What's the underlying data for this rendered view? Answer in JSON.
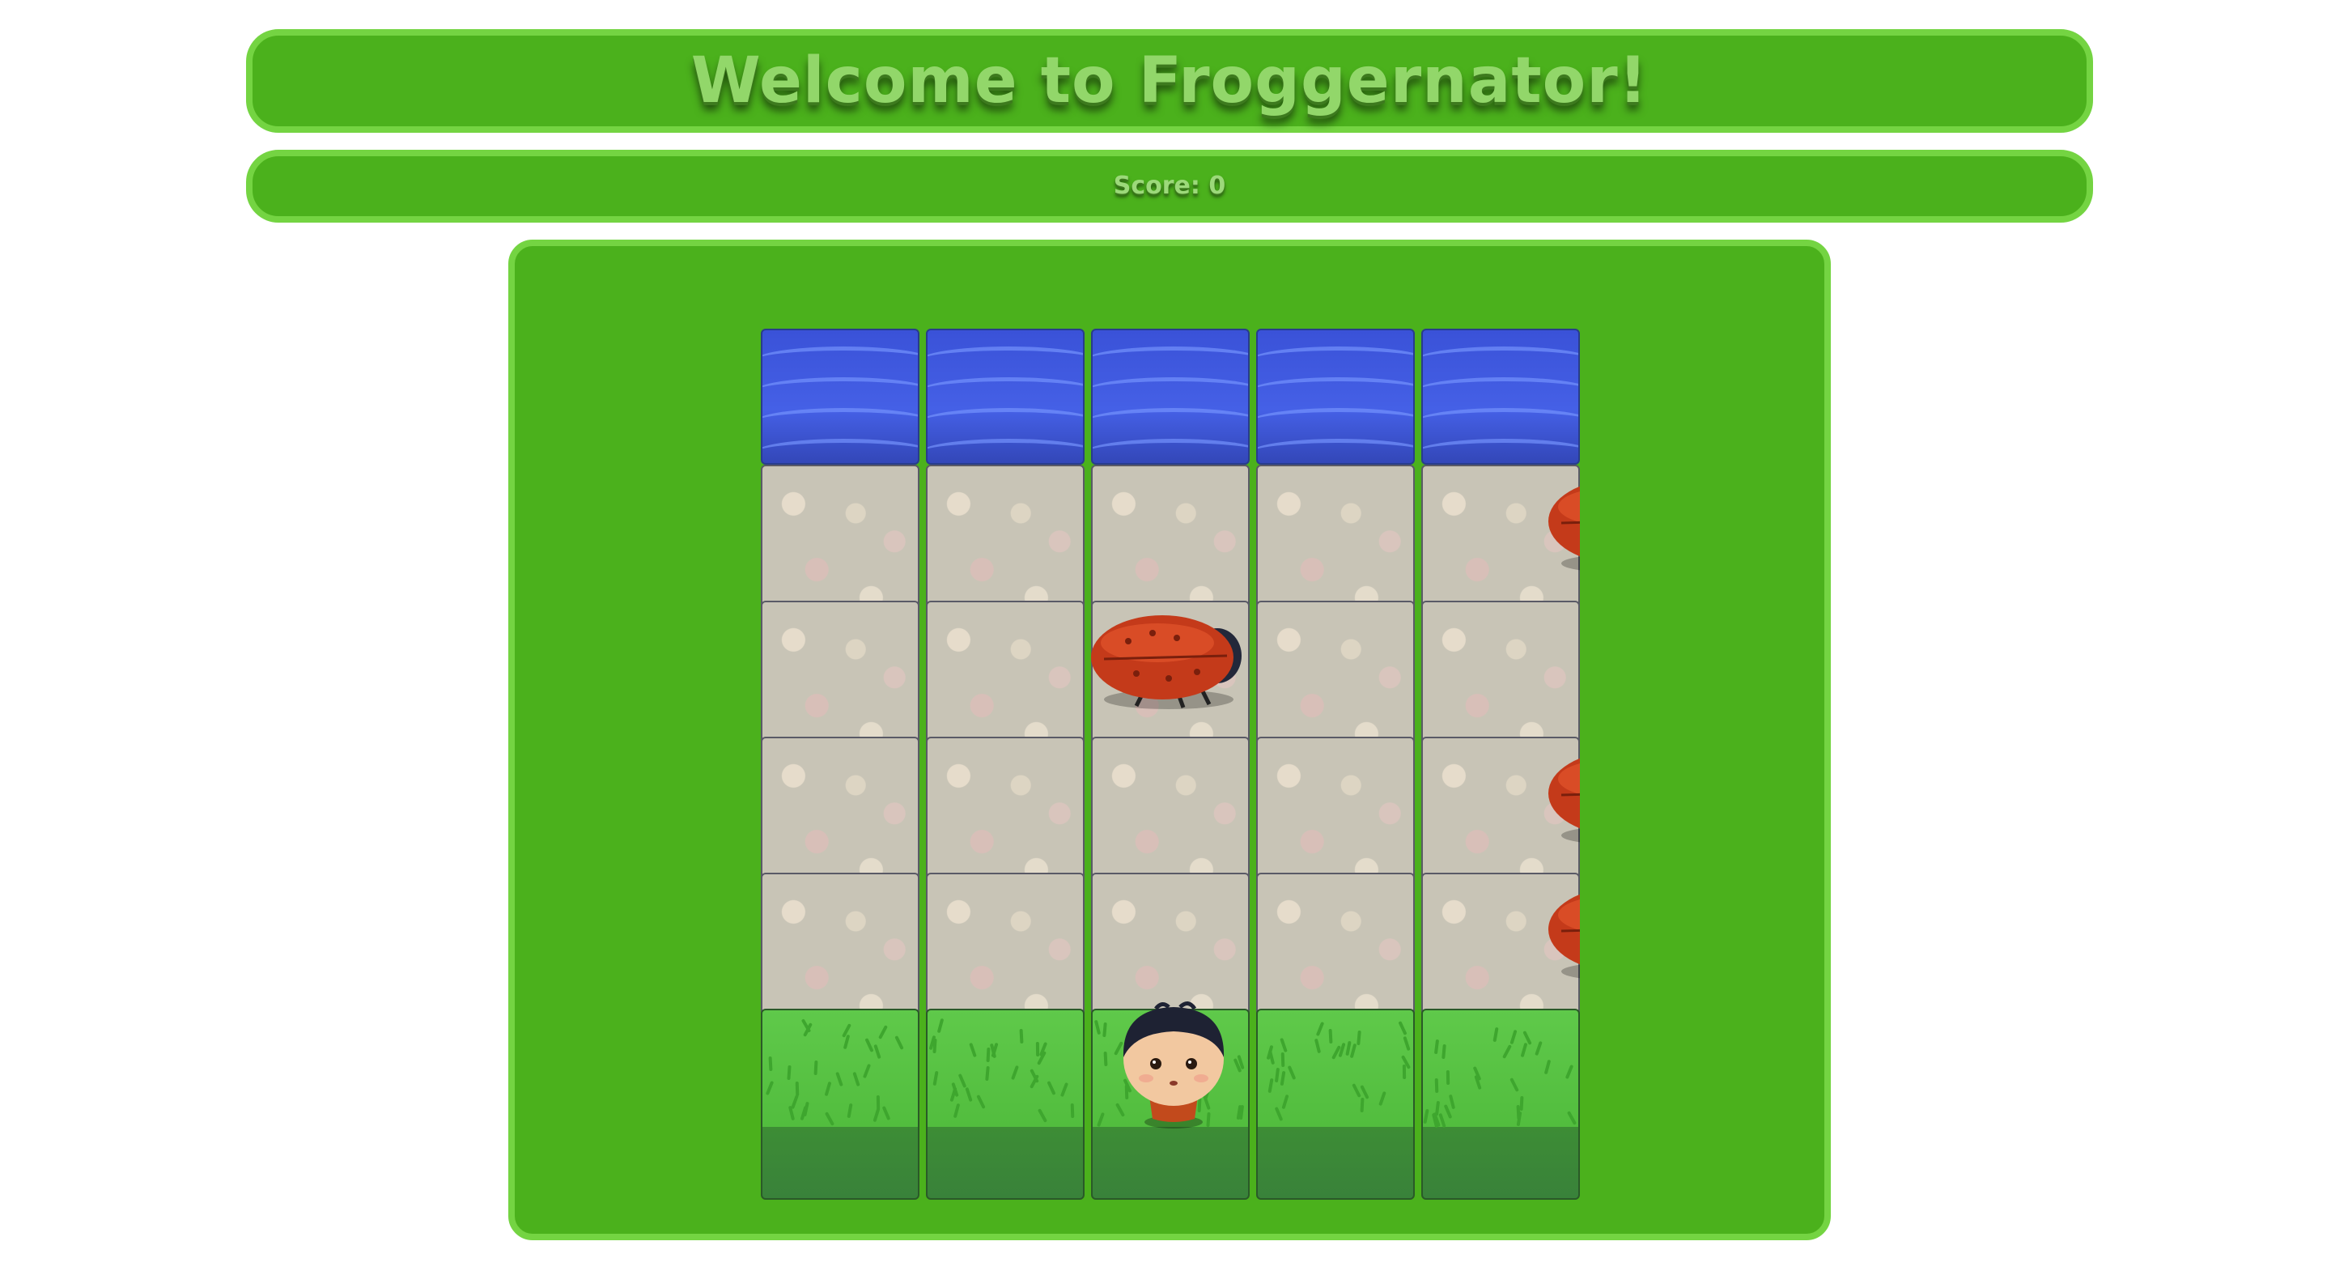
{
  "header": {
    "title": "Welcome to Froggernator!"
  },
  "scoreboard": {
    "score_text": "Score: 0"
  },
  "board": {
    "columns": 5,
    "rows": [
      "water",
      "stone",
      "stone",
      "stone",
      "stone",
      "grass"
    ],
    "enemies": [
      {
        "row": 1,
        "col": 4.75
      },
      {
        "row": 2,
        "col": 1.98
      },
      {
        "row": 3,
        "col": 4.75
      },
      {
        "row": 4,
        "col": 4.75
      }
    ],
    "player": {
      "row": 5,
      "col": 2
    }
  },
  "colors": {
    "panel_green": "#4bb11c",
    "panel_border": "#74d442",
    "water": "#4560e6",
    "stone": "#c8c4b6",
    "grass": "#52bd3e",
    "bug_shell": "#c43a1a"
  },
  "icons": {
    "enemy": "ladybug-enemy-icon",
    "player": "boy-player-icon"
  }
}
